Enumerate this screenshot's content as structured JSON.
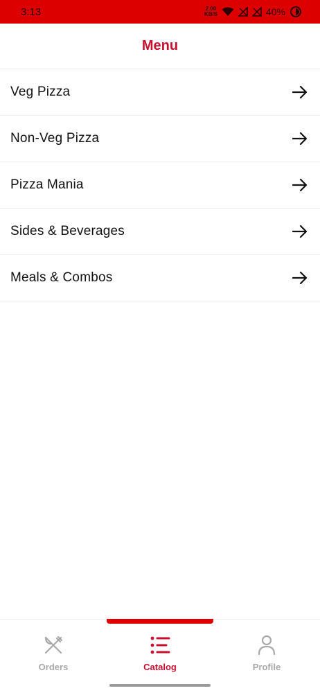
{
  "status_bar": {
    "time": "3:13",
    "net_speed_value": "2.00",
    "net_speed_unit": "KB/S",
    "battery": "40%"
  },
  "header": {
    "title": "Menu"
  },
  "menu": {
    "items": [
      {
        "label": "Veg Pizza"
      },
      {
        "label": "Non-Veg Pizza"
      },
      {
        "label": "Pizza Mania"
      },
      {
        "label": "Sides & Beverages"
      },
      {
        "label": "Meals & Combos"
      }
    ]
  },
  "bottom_nav": {
    "tabs": [
      {
        "label": "Orders",
        "icon": "fork-knife-icon",
        "active": false
      },
      {
        "label": "Catalog",
        "icon": "list-icon",
        "active": true
      },
      {
        "label": "Profile",
        "icon": "person-icon",
        "active": false
      }
    ]
  },
  "colors": {
    "brand_red": "#dc0000",
    "title_red": "#c8102e",
    "inactive_gray": "#a8a8a8"
  }
}
